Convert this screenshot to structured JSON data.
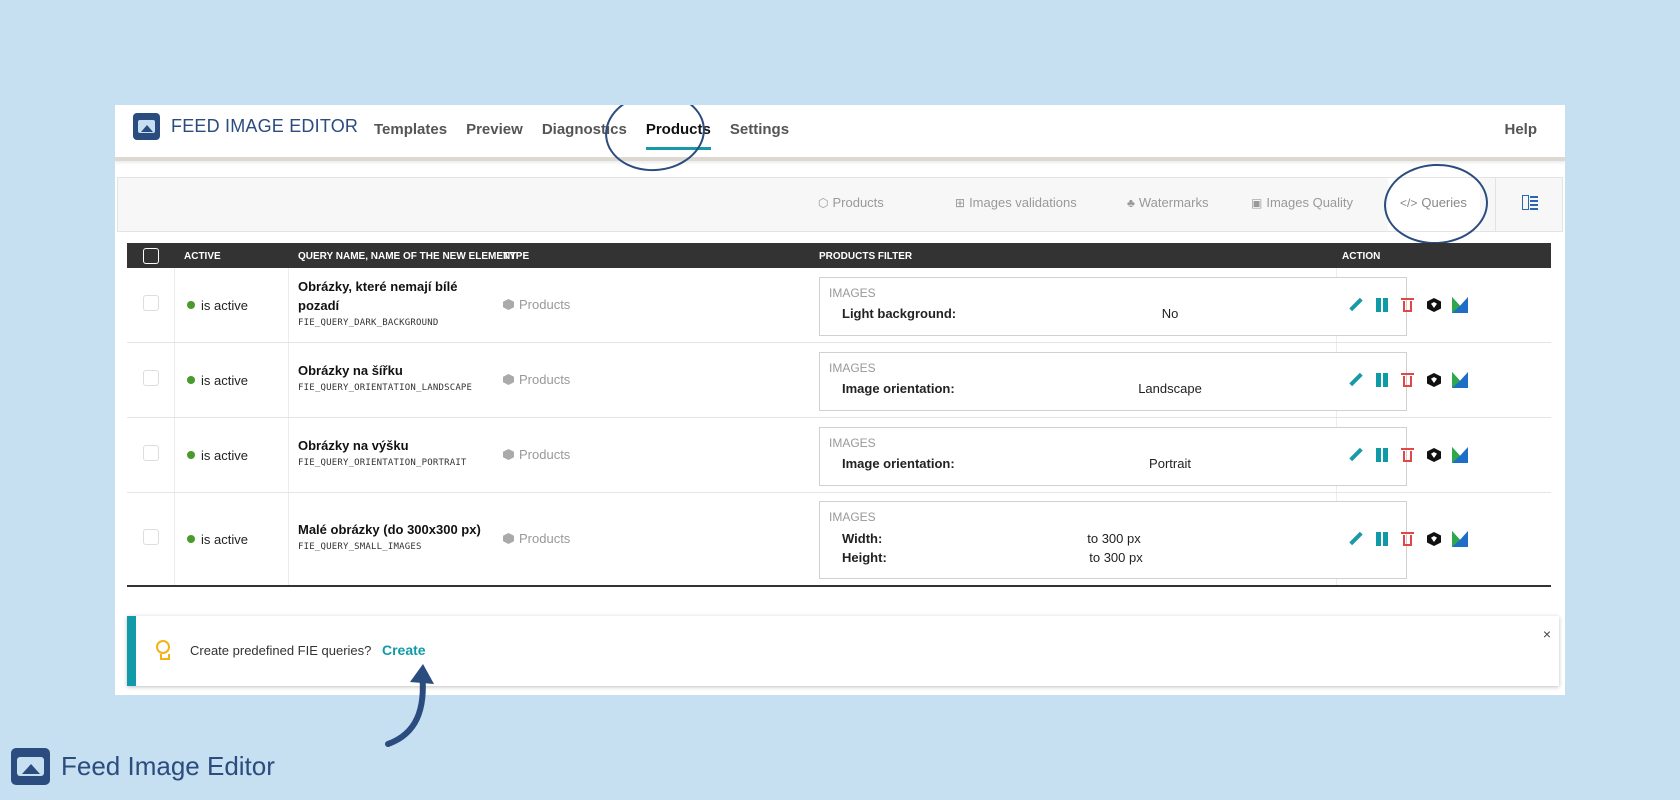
{
  "app": {
    "brand": "FEED IMAGE EDITOR",
    "nav": [
      "Templates",
      "Preview",
      "Diagnostics",
      "Products",
      "Settings"
    ],
    "nav_active": "Products",
    "help": "Help"
  },
  "subtabs": [
    {
      "label": "Products",
      "icon": "box-icon"
    },
    {
      "label": "Images validations",
      "icon": "grid-icon"
    },
    {
      "label": "Watermarks",
      "icon": "paw-icon"
    },
    {
      "label": "Images Quality",
      "icon": "image-icon"
    },
    {
      "label": "Queries",
      "icon": "code-icon"
    }
  ],
  "subtab_active": "Queries",
  "table": {
    "headers": {
      "active": "ACTIVE",
      "name": "QUERY NAME, NAME OF THE NEW ELEMENT",
      "type": "TYPE",
      "filter": "PRODUCTS FILTER",
      "action": "ACTION"
    },
    "rows": [
      {
        "status": "is active",
        "title": "Obrázky, které nemají bílé pozadí",
        "code": "FIE_QUERY_DARK_BACKGROUND",
        "type": "Products",
        "filter_group": "IMAGES",
        "filters": [
          {
            "key": "Light background:",
            "value": "No"
          }
        ]
      },
      {
        "status": "is active",
        "title": "Obrázky na šířku",
        "code": "FIE_QUERY_ORIENTATION_LANDSCAPE",
        "type": "Products",
        "filter_group": "IMAGES",
        "filters": [
          {
            "key": "Image orientation:",
            "value": "Landscape"
          }
        ]
      },
      {
        "status": "is active",
        "title": "Obrázky na výšku",
        "code": "FIE_QUERY_ORIENTATION_PORTRAIT",
        "type": "Products",
        "filter_group": "IMAGES",
        "filters": [
          {
            "key": "Image orientation:",
            "value": "Portrait"
          }
        ]
      },
      {
        "status": "is active",
        "title": "Malé obrázky (do 300x300 px)",
        "code": "FIE_QUERY_SMALL_IMAGES",
        "type": "Products",
        "filter_group": "IMAGES",
        "filters": [
          {
            "key": "Width:",
            "value": "to 300 px"
          },
          {
            "key": "Height:",
            "value": "to 300 px"
          }
        ]
      }
    ]
  },
  "notice": {
    "text": "Create predefined FIE queries?",
    "action": "Create",
    "close": "×"
  },
  "footer": {
    "brand": "Feed Image Editor"
  },
  "colors": {
    "background": "#c6dff1",
    "brand": "#2b4c7e",
    "accent": "#119aa8",
    "active_dot": "#4a9a2e",
    "delete": "#e04848"
  }
}
